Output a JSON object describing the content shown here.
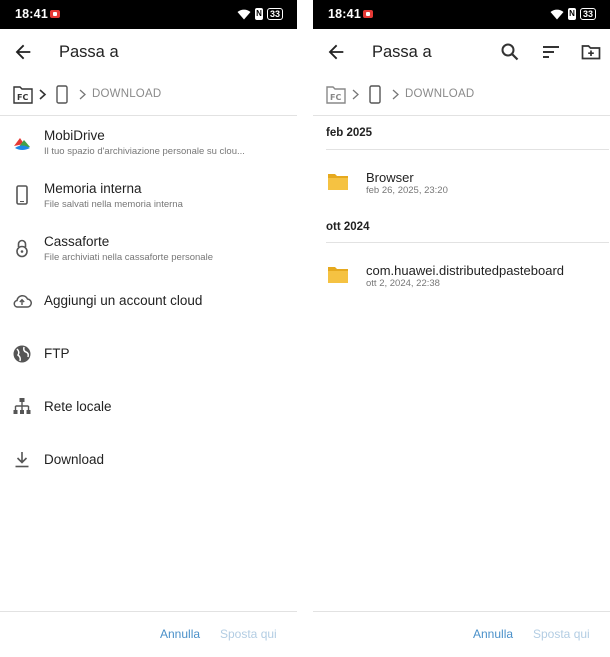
{
  "status_bar": {
    "time": "18:41",
    "battery": "33"
  },
  "left": {
    "title": "Passa a",
    "breadcrumb": "DOWNLOAD",
    "items": [
      {
        "title": "MobiDrive",
        "subtitle": "Il tuo spazio d'archiviazione personale su clou...",
        "icon": "mobidrive-icon"
      },
      {
        "title": "Memoria interna",
        "subtitle": "File salvati nella memoria interna",
        "icon": "phone-icon"
      },
      {
        "title": "Cassaforte",
        "subtitle": "File archiviati nella cassaforte personale",
        "icon": "vault-icon"
      },
      {
        "title": "Aggiungi un account cloud",
        "icon": "cloud-upload-icon"
      },
      {
        "title": "FTP",
        "icon": "globe-icon"
      },
      {
        "title": "Rete locale",
        "icon": "network-icon"
      },
      {
        "title": "Download",
        "icon": "download-icon"
      }
    ],
    "cancel_label": "Annulla",
    "move_label": "Sposta qui"
  },
  "right": {
    "title": "Passa a",
    "breadcrumb": "DOWNLOAD",
    "sections": [
      {
        "header": "feb 2025",
        "files": [
          {
            "name": "Browser",
            "date": "feb 26, 2025, 23:20"
          }
        ]
      },
      {
        "header": "ott 2024",
        "files": [
          {
            "name": "com.huawei.distributedpasteboard",
            "date": "ott 2, 2024, 22:38"
          }
        ]
      }
    ],
    "cancel_label": "Annulla",
    "move_label": "Sposta qui"
  },
  "colors": {
    "accent": "#4a90c9",
    "accent_disabled": "#b3cde3",
    "folder": "#f5c242",
    "status_bar": "#000000"
  }
}
